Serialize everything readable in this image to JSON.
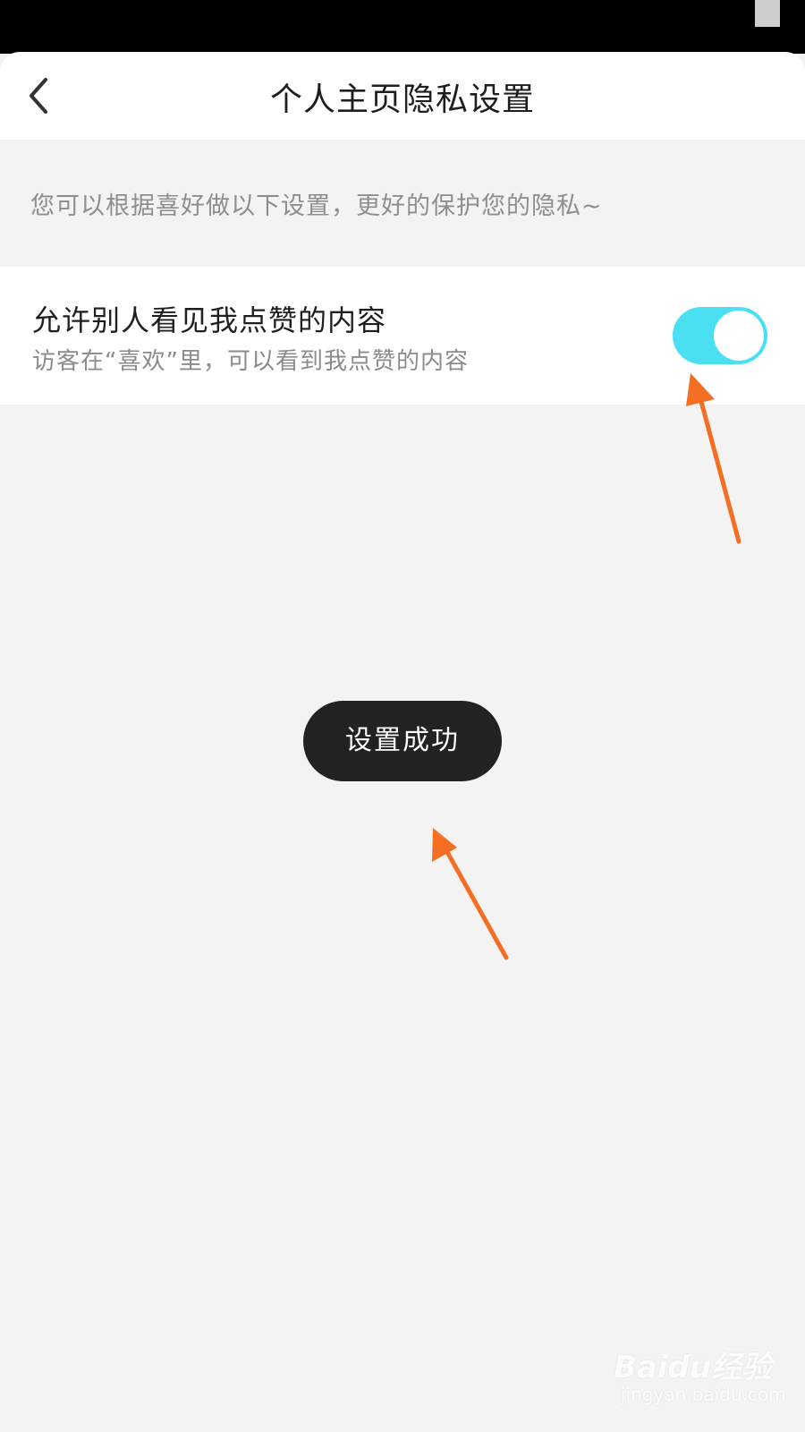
{
  "header": {
    "title": "个人主页隐私设置"
  },
  "intro": {
    "text": "您可以根据喜好做以下设置，更好的保护您的隐私~"
  },
  "setting": {
    "title": "允许别人看见我点赞的内容",
    "description": "访客在“喜欢”里，可以看到我点赞的内容",
    "enabled": true
  },
  "toast": {
    "text": "设置成功"
  },
  "watermark": {
    "brand": "Baidu经验",
    "url": "jingyan.baidu.com"
  },
  "colors": {
    "toggle_on": "#4ae0f2",
    "arrow": "#f46f24",
    "toast_bg": "#222222"
  },
  "icons": {
    "back": "chevron-left-icon",
    "status": "status-icon"
  }
}
